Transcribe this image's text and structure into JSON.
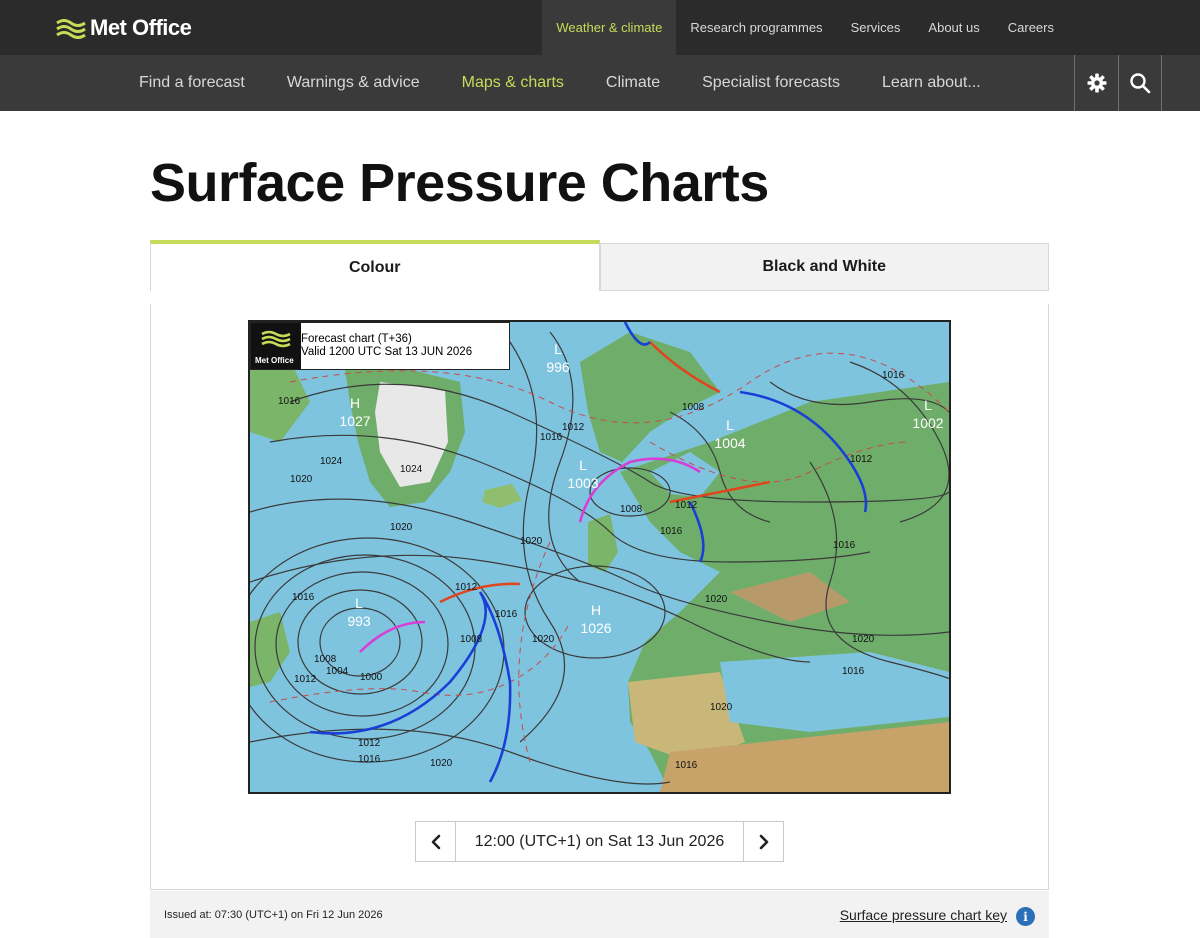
{
  "brand": {
    "name": "Met Office"
  },
  "top_nav": {
    "items": [
      {
        "label": "Weather & climate",
        "active": true
      },
      {
        "label": "Research programmes",
        "active": false
      },
      {
        "label": "Services",
        "active": false
      },
      {
        "label": "About us",
        "active": false
      },
      {
        "label": "Careers",
        "active": false
      }
    ]
  },
  "main_nav": {
    "items": [
      {
        "label": "Find a forecast",
        "active": false
      },
      {
        "label": "Warnings & advice",
        "active": false
      },
      {
        "label": "Maps & charts",
        "active": true
      },
      {
        "label": "Climate",
        "active": false
      },
      {
        "label": "Specialist forecasts",
        "active": false
      },
      {
        "label": "Learn about...",
        "active": false
      }
    ],
    "settings_icon": "gear-icon",
    "search_icon": "search-icon"
  },
  "page": {
    "title": "Surface Pressure Charts"
  },
  "tabs": [
    {
      "label": "Colour",
      "active": true
    },
    {
      "label": "Black and White",
      "active": false
    }
  ],
  "chart": {
    "legend_line1": "Forecast chart (T+36)",
    "legend_line2": "Valid 1200 UTC Sat 13 JUN 2026",
    "badge_text": "Met Office",
    "pressure_centres": [
      {
        "type": "H",
        "value": "1027"
      },
      {
        "type": "L",
        "value": "996"
      },
      {
        "type": "L",
        "value": "1004"
      },
      {
        "type": "L",
        "value": "1002"
      },
      {
        "type": "L",
        "value": "1003"
      },
      {
        "type": "L",
        "value": "993"
      },
      {
        "type": "H",
        "value": "1026"
      }
    ],
    "isobar_labels": [
      "1016",
      "1020",
      "1024",
      "1020",
      "1016",
      "1012",
      "1008",
      "1004",
      "1000",
      "1008",
      "1012",
      "1016",
      "1020",
      "1012",
      "1016",
      "1020",
      "1024",
      "1016",
      "1020",
      "1008",
      "1012",
      "1016",
      "1020",
      "1016",
      "1016",
      "1008",
      "1012",
      "1016",
      "1020",
      "1020",
      "1012",
      "1016"
    ]
  },
  "time_control": {
    "current": "12:00 (UTC+1) on Sat 13 Jun 2026",
    "prev_icon": "chevron-left-icon",
    "next_icon": "chevron-right-icon"
  },
  "footer": {
    "issued": "Issued at: 07:30 (UTC+1) on Fri 12 Jun 2026",
    "key_link": "Surface pressure chart key",
    "info_icon": "i"
  },
  "colors": {
    "accent": "#c6dc58",
    "topbar": "#2b2b2b",
    "navbar": "#3a3a3a",
    "sea": "#7fc4df",
    "land": "#6fae6a",
    "cold_front": "#1a3fd6",
    "warm_front": "#e0461e",
    "occluded_front": "#d63fd6"
  }
}
